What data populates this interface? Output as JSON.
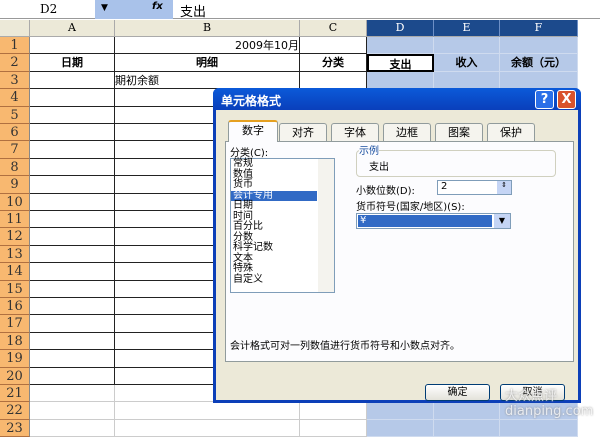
{
  "formula_bar": {
    "name_box": "D2",
    "dropdown_icon": "▼",
    "fx_label": "fx",
    "value": "支出"
  },
  "columns": [
    "A",
    "B",
    "C",
    "D",
    "E",
    "F"
  ],
  "rows": [
    "1",
    "2",
    "3",
    "4",
    "5",
    "6",
    "7",
    "8",
    "9",
    "10",
    "11",
    "12",
    "13",
    "14",
    "15",
    "16",
    "17",
    "18",
    "19",
    "20",
    "21",
    "22",
    "23"
  ],
  "cells": {
    "title": "2009年10月",
    "headers": [
      "日期",
      "明细",
      "分类",
      "支出",
      "收入",
      "余额（元）"
    ],
    "b3": "期初余额"
  },
  "dialog": {
    "title": "单元格格式",
    "help": "?",
    "close": "X",
    "tabs": [
      "数字",
      "对齐",
      "字体",
      "边框",
      "图案",
      "保护"
    ],
    "category_label": "分类(C):",
    "categories": [
      "常规",
      "数值",
      "货币",
      "会计专用",
      "日期",
      "时间",
      "百分比",
      "分数",
      "科学记数",
      "文本",
      "特殊",
      "自定义"
    ],
    "selected_category": "会计专用",
    "sample_label": "示例",
    "sample_value": "支出",
    "decimal_label": "小数位数(D):",
    "decimal_value": "2",
    "currency_label": "货币符号(国家/地区)(S):",
    "currency_value": "¥",
    "description": "会计格式可对一列数值进行货币符号和小数点对齐。",
    "ok": "确定",
    "cancel": "取消"
  },
  "watermark": "大众点评 dianping.com"
}
